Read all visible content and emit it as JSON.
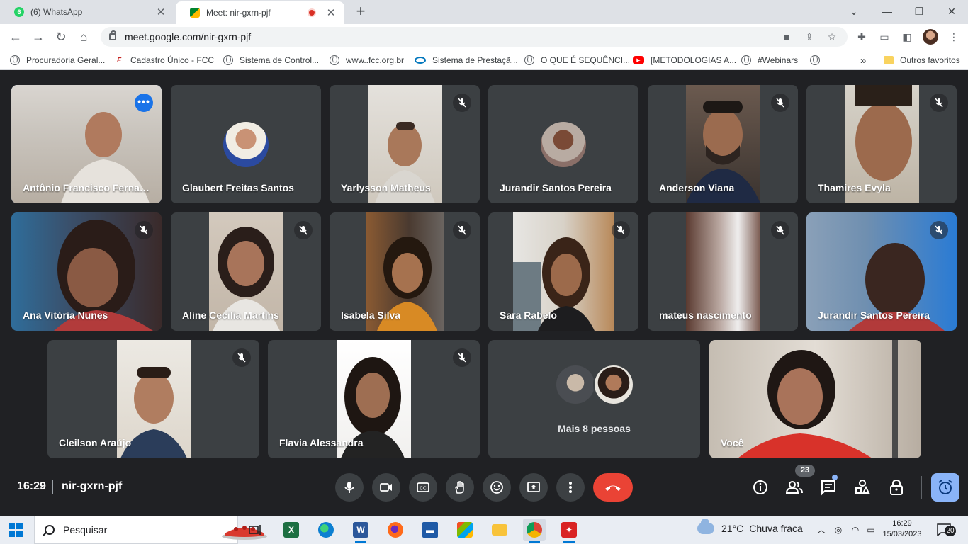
{
  "browser": {
    "tabs": [
      {
        "title": "(6) WhatsApp",
        "badge": "6",
        "active": false
      },
      {
        "title": "Meet: nir-gxrn-pjf",
        "active": true,
        "recording": true
      }
    ],
    "url": "meet.google.com/nir-gxrn-pjf",
    "bookmarks": [
      {
        "label": "Procuradoria Geral...",
        "icon": "globe-icon"
      },
      {
        "label": "Cadastro Único - FCC",
        "icon": "fcc-icon"
      },
      {
        "label": "Sistema de Control...",
        "icon": "globe-icon"
      },
      {
        "label": "www..fcc.org.br",
        "icon": "globe-icon"
      },
      {
        "label": "Sistema de Prestaçã...",
        "icon": "eye-icon"
      },
      {
        "label": "O QUE É SEQUÊNCI...",
        "icon": "globe-icon"
      },
      {
        "label": "[METODOLOGIAS A...",
        "icon": "youtube-icon"
      },
      {
        "label": "#Webinars",
        "icon": "globe-icon"
      },
      {
        "label": "",
        "icon": "globe-icon"
      }
    ],
    "bookmarks_overflow": "»",
    "other_bookmarks": "Outros favoritos"
  },
  "meet": {
    "participants": [
      {
        "name": "Antônio Francisco Fernan...",
        "speaking": true,
        "muted": false
      },
      {
        "name": "Glaubert Freitas Santos",
        "muted": false,
        "avatar": true
      },
      {
        "name": "Yarlysson Matheus",
        "muted": true
      },
      {
        "name": "Jurandir Santos Pereira",
        "muted": false,
        "avatar": true
      },
      {
        "name": "Anderson Viana",
        "muted": true
      },
      {
        "name": "Thamires Evyla",
        "muted": true
      },
      {
        "name": "Ana Vitória Nunes",
        "muted": true
      },
      {
        "name": "Aline Cecilia Martins",
        "muted": true
      },
      {
        "name": "Isabela Silva",
        "muted": true
      },
      {
        "name": "Sara Rabelo",
        "muted": true
      },
      {
        "name": "mateus nascimento",
        "muted": true
      },
      {
        "name": "Jurandir Santos Pereira",
        "muted": true
      },
      {
        "name": "Cleilson Araújo",
        "muted": true
      },
      {
        "name": "Flavia Alessandra",
        "muted": true
      },
      {
        "name": "Você",
        "muted": false
      }
    ],
    "others_label": "Mais 8 pessoas",
    "time": "16:29",
    "meeting_code": "nir-gxrn-pjf",
    "participant_count": "23"
  },
  "taskbar": {
    "search_placeholder": "Pesquisar",
    "weather_temp": "21°C",
    "weather_desc": "Chuva fraca",
    "clock_time": "16:29",
    "clock_date": "15/03/2023",
    "notification_count": "20"
  },
  "colors": {
    "meet_bg": "#202124",
    "tile_bg": "#3c4043",
    "end_call": "#ea4335",
    "accent": "#8ab4f8"
  }
}
